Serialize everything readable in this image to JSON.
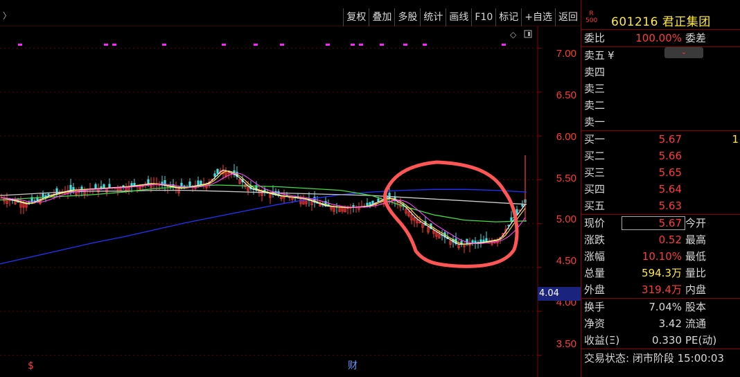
{
  "toolbar": {
    "arrow": "〉",
    "buttons": [
      "复权",
      "叠加",
      "多股",
      "统计",
      "画线",
      "F10",
      "标记",
      "+自选",
      "返回"
    ]
  },
  "chart": {
    "y_ticks": [
      "7.00",
      "6.50",
      "6.00",
      "5.50",
      "5.00",
      "4.50",
      "4.00",
      "3.50"
    ],
    "current_price_tag": "4.04",
    "bottom_markers": [
      "$",
      "财"
    ],
    "colors": {
      "ma5": "#ffffff",
      "ma10": "#ffeb3b",
      "ma20": "#ff44ff",
      "ma60": "#44dd44",
      "ma120": "#cccccc",
      "ma250": "#2233ff",
      "up": "#ff3b3b",
      "down": "#44dddd",
      "annotation": "#ff5555",
      "markers": "#ff22ff"
    }
  },
  "chart_data": {
    "type": "line",
    "ylim": [
      3.25,
      7.25
    ],
    "y_ticks": [
      7.0,
      6.5,
      6.0,
      5.5,
      5.0,
      4.5,
      4.0,
      3.5
    ],
    "series": [
      {
        "name": "",
        "key": "ma250",
        "values": [
          4.54,
          4.62,
          4.7,
          4.78,
          4.85,
          4.93,
          5.01,
          5.08,
          5.15,
          5.22,
          5.28,
          5.33,
          5.36,
          5.38,
          5.39,
          5.39,
          5.38,
          5.36
        ]
      },
      {
        "name": "",
        "key": "ma120",
        "values": [
          5.32,
          5.34,
          5.36,
          5.37,
          5.37,
          5.38,
          5.38,
          5.37,
          5.36,
          5.35,
          5.34,
          5.33,
          5.32,
          5.3,
          5.28,
          5.26,
          5.24,
          5.22
        ]
      },
      {
        "name": "",
        "key": "ma60",
        "values": [
          5.27,
          5.29,
          5.31,
          5.33,
          5.36,
          5.4,
          5.42,
          5.44,
          5.43,
          5.42,
          5.4,
          5.38,
          5.32,
          5.2,
          5.1,
          5.04,
          5.02,
          5.03
        ]
      }
    ]
  },
  "stock": {
    "badge_top": "R",
    "badge_bottom": "500",
    "title": "601216 君正集团"
  },
  "quote": {
    "ratio_label": "委比",
    "ratio_value": "100.00%",
    "ratio_diff_label": "委差",
    "sell_labels": [
      "卖五",
      "卖四",
      "卖三",
      "卖二",
      "卖一"
    ],
    "sell_five_suffix": "¥",
    "buy": [
      {
        "label": "买一",
        "price": "5.67",
        "vol": "1"
      },
      {
        "label": "买二",
        "price": "5.66",
        "vol": ""
      },
      {
        "label": "买三",
        "price": "5.65",
        "vol": ""
      },
      {
        "label": "买四",
        "price": "5.64",
        "vol": ""
      },
      {
        "label": "买五",
        "price": "5.63",
        "vol": ""
      }
    ],
    "stats": [
      {
        "label": "现价",
        "value": "5.67",
        "label2": "今开",
        "color": "red"
      },
      {
        "label": "涨跌",
        "value": "0.52",
        "label2": "最高",
        "color": "red"
      },
      {
        "label": "涨幅",
        "value": "10.10%",
        "label2": "最低",
        "color": "red"
      },
      {
        "label": "总量",
        "value": "594.3万",
        "label2": "量比",
        "color": "yellow"
      },
      {
        "label": "外盘",
        "value": "319.4万",
        "label2": "内盘",
        "color": "red"
      }
    ],
    "info": [
      {
        "label": "换手",
        "value": "7.04%",
        "label2": "股本"
      },
      {
        "label": "净资",
        "value": "3.42",
        "label2": "流通"
      },
      {
        "label": "收益(Ξ)",
        "value": "0.330",
        "label2": "PE(动)"
      }
    ],
    "status": "交易状态: 闭市阶段 15:00:03"
  }
}
